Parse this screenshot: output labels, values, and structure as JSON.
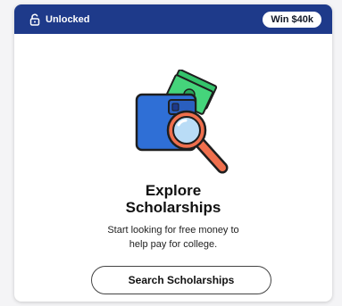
{
  "header": {
    "status_label": "Unlocked",
    "status_icon": "unlock-icon",
    "badge_label": "Win $40k",
    "background_color": "#1e3a8a"
  },
  "main": {
    "illustration_icon": "wallet-money-magnifier-illustration",
    "title_line1": "Explore",
    "title_line2": "Scholarships",
    "description_line1": "Start looking for free money to",
    "description_line2": "help pay for college.",
    "cta_label": "Search Scholarships"
  },
  "colors": {
    "wallet_blue": "#2f6fd6",
    "money_green": "#34c36b",
    "magnifier_orange": "#ef6f4d",
    "lens_blue": "#b9dcf6"
  }
}
